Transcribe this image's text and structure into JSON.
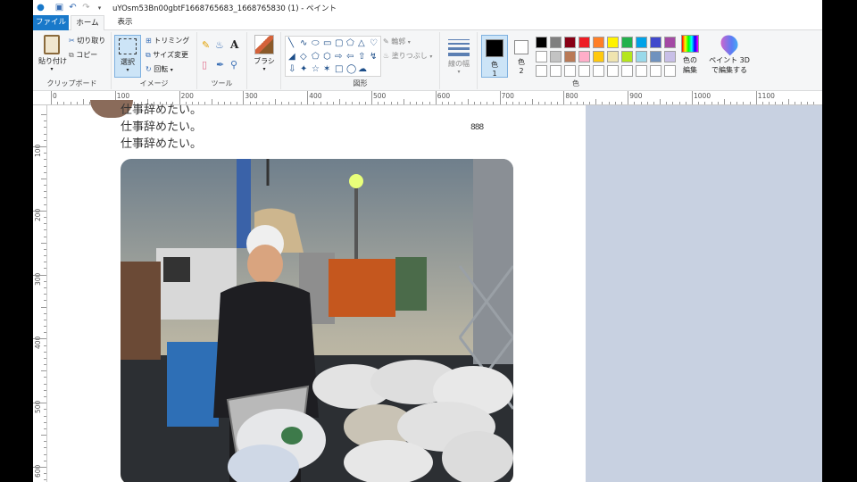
{
  "window": {
    "title": "uYOsm53Bn00gbtF1668765683_1668765830 (1) - ペイント"
  },
  "tabs": {
    "file": "ファイル",
    "home": "ホーム",
    "view": "表示"
  },
  "ribbon": {
    "clipboard": {
      "paste": "貼り付け",
      "cut": "切り取り",
      "copy": "コピー",
      "label": "クリップボード"
    },
    "image": {
      "select": "選択",
      "crop": "トリミング",
      "resize": "サイズ変更",
      "rotate": "回転",
      "label": "イメージ"
    },
    "tools": {
      "label": "ツール"
    },
    "brushes": {
      "label": "ブラシ"
    },
    "shapes": {
      "outline": "輪郭",
      "fill": "塗りつぶし",
      "label": "図形"
    },
    "size": {
      "label": "線の幅"
    },
    "colors": {
      "color1": "色\n1",
      "color1_a": "色",
      "color1_b": "1",
      "color2_a": "色",
      "color2_b": "2",
      "edit_a": "色の",
      "edit_b": "編集",
      "paint3d_a": "ペイント 3D",
      "paint3d_b": "で編集する",
      "label": "色",
      "color1_value": "#000000",
      "color2_value": "#ffffff",
      "palette_row1": [
        "#000000",
        "#7f7f7f",
        "#880015",
        "#ed1c24",
        "#ff7f27",
        "#fff200",
        "#22b14c",
        "#00a2e8",
        "#3f48cc",
        "#a349a4"
      ],
      "palette_row2": [
        "#ffffff",
        "#c3c3c3",
        "#b97a57",
        "#ffaec9",
        "#ffc90e",
        "#efe4b0",
        "#b5e61d",
        "#99d9ea",
        "#7092be",
        "#c8bfe7"
      ],
      "palette_row3": [
        "#ffffff",
        "#ffffff",
        "#ffffff",
        "#ffffff",
        "#ffffff",
        "#ffffff",
        "#ffffff",
        "#ffffff",
        "#ffffff",
        "#ffffff"
      ]
    }
  },
  "ruler_h": [
    "0",
    "100",
    "200",
    "300",
    "400",
    "500",
    "600",
    "700",
    "800",
    "900",
    "1000",
    "1100"
  ],
  "ruler_v": [
    "100",
    "200",
    "300",
    "400",
    "500",
    "600"
  ],
  "canvas": {
    "tweet_lines": [
      "仕事辞めたい。",
      "仕事辞めたい。",
      "仕事辞めたい。"
    ],
    "mark": "888"
  }
}
